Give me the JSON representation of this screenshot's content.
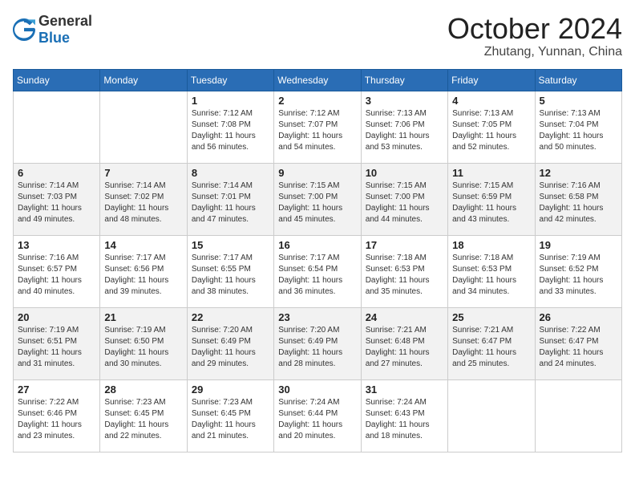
{
  "header": {
    "logo": {
      "general": "General",
      "blue": "Blue"
    },
    "month": "October 2024",
    "location": "Zhutang, Yunnan, China"
  },
  "weekdays": [
    "Sunday",
    "Monday",
    "Tuesday",
    "Wednesday",
    "Thursday",
    "Friday",
    "Saturday"
  ],
  "weeks": [
    [
      {
        "day": "",
        "info": ""
      },
      {
        "day": "",
        "info": ""
      },
      {
        "day": "1",
        "info": "Sunrise: 7:12 AM\nSunset: 7:08 PM\nDaylight: 11 hours and 56 minutes."
      },
      {
        "day": "2",
        "info": "Sunrise: 7:12 AM\nSunset: 7:07 PM\nDaylight: 11 hours and 54 minutes."
      },
      {
        "day": "3",
        "info": "Sunrise: 7:13 AM\nSunset: 7:06 PM\nDaylight: 11 hours and 53 minutes."
      },
      {
        "day": "4",
        "info": "Sunrise: 7:13 AM\nSunset: 7:05 PM\nDaylight: 11 hours and 52 minutes."
      },
      {
        "day": "5",
        "info": "Sunrise: 7:13 AM\nSunset: 7:04 PM\nDaylight: 11 hours and 50 minutes."
      }
    ],
    [
      {
        "day": "6",
        "info": "Sunrise: 7:14 AM\nSunset: 7:03 PM\nDaylight: 11 hours and 49 minutes."
      },
      {
        "day": "7",
        "info": "Sunrise: 7:14 AM\nSunset: 7:02 PM\nDaylight: 11 hours and 48 minutes."
      },
      {
        "day": "8",
        "info": "Sunrise: 7:14 AM\nSunset: 7:01 PM\nDaylight: 11 hours and 47 minutes."
      },
      {
        "day": "9",
        "info": "Sunrise: 7:15 AM\nSunset: 7:00 PM\nDaylight: 11 hours and 45 minutes."
      },
      {
        "day": "10",
        "info": "Sunrise: 7:15 AM\nSunset: 7:00 PM\nDaylight: 11 hours and 44 minutes."
      },
      {
        "day": "11",
        "info": "Sunrise: 7:15 AM\nSunset: 6:59 PM\nDaylight: 11 hours and 43 minutes."
      },
      {
        "day": "12",
        "info": "Sunrise: 7:16 AM\nSunset: 6:58 PM\nDaylight: 11 hours and 42 minutes."
      }
    ],
    [
      {
        "day": "13",
        "info": "Sunrise: 7:16 AM\nSunset: 6:57 PM\nDaylight: 11 hours and 40 minutes."
      },
      {
        "day": "14",
        "info": "Sunrise: 7:17 AM\nSunset: 6:56 PM\nDaylight: 11 hours and 39 minutes."
      },
      {
        "day": "15",
        "info": "Sunrise: 7:17 AM\nSunset: 6:55 PM\nDaylight: 11 hours and 38 minutes."
      },
      {
        "day": "16",
        "info": "Sunrise: 7:17 AM\nSunset: 6:54 PM\nDaylight: 11 hours and 36 minutes."
      },
      {
        "day": "17",
        "info": "Sunrise: 7:18 AM\nSunset: 6:53 PM\nDaylight: 11 hours and 35 minutes."
      },
      {
        "day": "18",
        "info": "Sunrise: 7:18 AM\nSunset: 6:53 PM\nDaylight: 11 hours and 34 minutes."
      },
      {
        "day": "19",
        "info": "Sunrise: 7:19 AM\nSunset: 6:52 PM\nDaylight: 11 hours and 33 minutes."
      }
    ],
    [
      {
        "day": "20",
        "info": "Sunrise: 7:19 AM\nSunset: 6:51 PM\nDaylight: 11 hours and 31 minutes."
      },
      {
        "day": "21",
        "info": "Sunrise: 7:19 AM\nSunset: 6:50 PM\nDaylight: 11 hours and 30 minutes."
      },
      {
        "day": "22",
        "info": "Sunrise: 7:20 AM\nSunset: 6:49 PM\nDaylight: 11 hours and 29 minutes."
      },
      {
        "day": "23",
        "info": "Sunrise: 7:20 AM\nSunset: 6:49 PM\nDaylight: 11 hours and 28 minutes."
      },
      {
        "day": "24",
        "info": "Sunrise: 7:21 AM\nSunset: 6:48 PM\nDaylight: 11 hours and 27 minutes."
      },
      {
        "day": "25",
        "info": "Sunrise: 7:21 AM\nSunset: 6:47 PM\nDaylight: 11 hours and 25 minutes."
      },
      {
        "day": "26",
        "info": "Sunrise: 7:22 AM\nSunset: 6:47 PM\nDaylight: 11 hours and 24 minutes."
      }
    ],
    [
      {
        "day": "27",
        "info": "Sunrise: 7:22 AM\nSunset: 6:46 PM\nDaylight: 11 hours and 23 minutes."
      },
      {
        "day": "28",
        "info": "Sunrise: 7:23 AM\nSunset: 6:45 PM\nDaylight: 11 hours and 22 minutes."
      },
      {
        "day": "29",
        "info": "Sunrise: 7:23 AM\nSunset: 6:45 PM\nDaylight: 11 hours and 21 minutes."
      },
      {
        "day": "30",
        "info": "Sunrise: 7:24 AM\nSunset: 6:44 PM\nDaylight: 11 hours and 20 minutes."
      },
      {
        "day": "31",
        "info": "Sunrise: 7:24 AM\nSunset: 6:43 PM\nDaylight: 11 hours and 18 minutes."
      },
      {
        "day": "",
        "info": ""
      },
      {
        "day": "",
        "info": ""
      }
    ]
  ]
}
